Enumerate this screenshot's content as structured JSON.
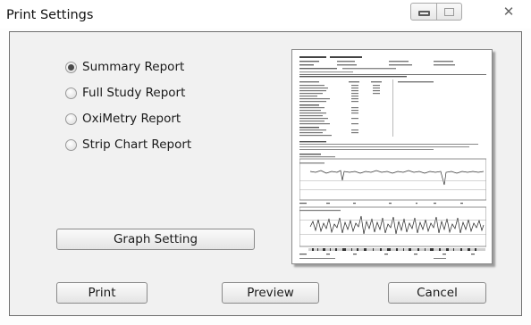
{
  "window": {
    "title": "Print Settings"
  },
  "title_buttons": {
    "minimize_icon": "minimize-icon",
    "maximize_icon": "maximize-icon",
    "close_icon": "close-icon",
    "close_glyph": "✕"
  },
  "report_options": [
    {
      "label": "Summary Report",
      "checked": true
    },
    {
      "label": "Full Study Report",
      "checked": false
    },
    {
      "label": "OxiMetry Report",
      "checked": false
    },
    {
      "label": "Strip Chart Report",
      "checked": false
    }
  ],
  "buttons": {
    "graph_setting": "Graph Setting",
    "print": "Print",
    "preview": "Preview",
    "cancel": "Cancel"
  }
}
